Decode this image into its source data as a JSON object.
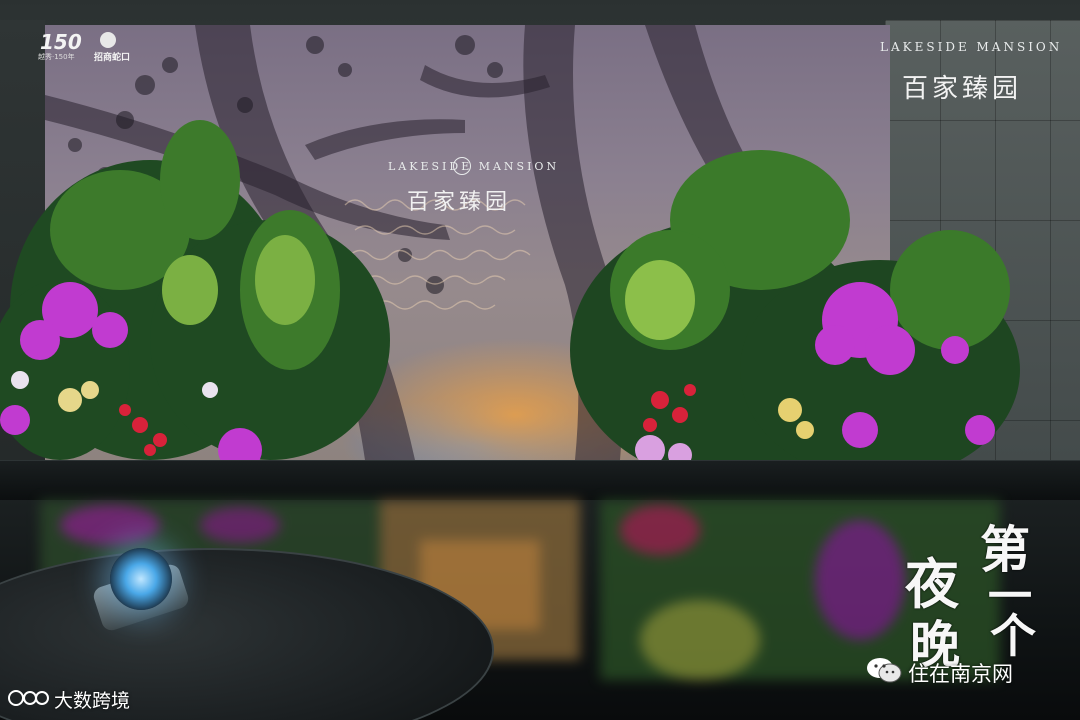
{
  "top_left_logos": {
    "logo_a_text": "150",
    "logo_a_caption": "越秀·150年",
    "logo_b_text": "招商蛇口"
  },
  "top_right_brand": {
    "english": "LAKESIDE MANSION",
    "chinese": "百家臻园"
  },
  "backdrop_brand": {
    "english": "LAKESIDE MANSION",
    "chinese": "百家臻园"
  },
  "calligraphy": {
    "chars": [
      "第",
      "一",
      "个",
      "夜",
      "晚"
    ]
  },
  "watermarks": {
    "bottom_left": "大数跨境",
    "bottom_right": "住在南京网"
  },
  "colors": {
    "flower_magenta": "#c13bd0",
    "flower_red": "#d8223a",
    "lamp_blue": "#4aa8e8",
    "sunset_orange": "#eca046"
  },
  "icons": {
    "wechat": "wechat-icon",
    "monogram": "lm-monogram-icon"
  }
}
